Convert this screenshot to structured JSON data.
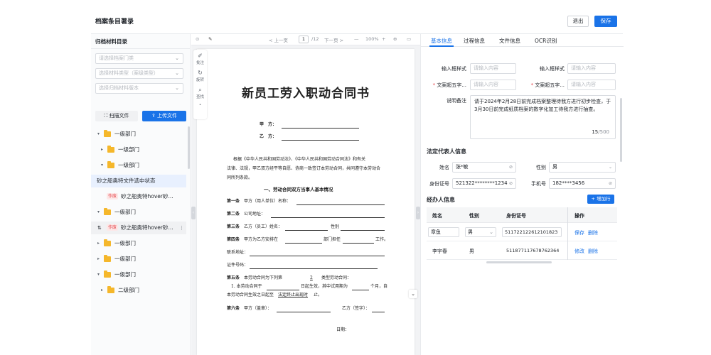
{
  "header": {
    "title": "档案条目著录",
    "exit_label": "退出",
    "save_label": "保存"
  },
  "sidebar": {
    "title": "归档材料目录",
    "selects": [
      {
        "placeholder": "请选择档案门类"
      },
      {
        "placeholder": "选择材料类型（案级类型）"
      },
      {
        "placeholder": "选择归档材料版本"
      }
    ],
    "scan_label": "扫描文件",
    "upload_label": "上传文件",
    "tree": [
      {
        "label": "一级部门",
        "type": "folder",
        "expanded": true
      },
      {
        "label": "一级部门",
        "type": "folder",
        "expanded": false
      },
      {
        "label": "一级部门",
        "type": "folder",
        "expanded": true
      },
      {
        "label": "砂之船奥特文件选中状态",
        "type": "file",
        "state": "selected"
      },
      {
        "label": "砂之船奥特hover砂...",
        "type": "file",
        "tag": "作废"
      },
      {
        "label": "一级部门",
        "type": "folder",
        "expanded": true
      },
      {
        "label": "砂之船奥特hover砂...",
        "type": "file",
        "tag": "作废",
        "state": "hover"
      },
      {
        "label": "一级部门",
        "type": "folder",
        "expanded": false
      },
      {
        "label": "一级部门",
        "type": "folder",
        "expanded": false
      },
      {
        "label": "一级部门",
        "type": "folder",
        "expanded": true
      },
      {
        "label": "二级部门",
        "type": "folder",
        "expanded": false
      }
    ]
  },
  "viewer": {
    "toolbar": {
      "prev": "< 上一页",
      "page": "1",
      "total": "/12",
      "next": "下一页 >",
      "zoom_out": "—",
      "zoom": "100%",
      "zoom_in": "+"
    },
    "side_tools": [
      "批注",
      "旋转",
      "查找"
    ],
    "doc": {
      "title": "新员工劳入职动合同书",
      "party_a": "甲　方：",
      "party_b": "乙　方：",
      "intro1": "根据《中华人民共和国劳动法》、《中华人民共和国劳动合同法》和有关",
      "intro2": "法律、法规，甲乙双方经平等自愿、协商一致签订本劳动合同，共同遵守本劳动合",
      "intro3": "同所列条款。",
      "section1": "一、劳动合同双方当事人基本情况",
      "a1": "第一条",
      "a1_text": "甲方（用人单位）名称：",
      "a2": "第二条",
      "a2_text": "公司地址：",
      "a3": "第三条",
      "a3_text": "乙方（员工）姓名：",
      "a3_gender": "性别",
      "a4": "第四条",
      "a4_text": "甲方为乙方安排在",
      "a4_dept": "部门担任",
      "a4_job": "工作。",
      "contact": "联系地址：",
      "id": "证件号码：",
      "a5": "第五条",
      "a5_text": "本劳动合同为下列第",
      "a5_num": "2",
      "a5_tail": "类型劳动合同：",
      "a5_1": "1. 本劳动合同于",
      "a5_1b": "日起生效，其中试用期为",
      "a5_1c": "个月，自",
      "a5_2": "本劳动合同生效之日起至",
      "a5_2b": "法定终止出现时",
      "a5_2c": "止。",
      "a6": "第六条",
      "a6_text": "甲方（盖章）：",
      "a6_b": "乙方（签字）：",
      "date": "日期："
    }
  },
  "panel": {
    "tabs": [
      "基本信息",
      "过程信息",
      "文件信息",
      "OCR识别"
    ],
    "fields": {
      "style1_label": "输入框样式",
      "style1_ph": "请输入内容",
      "style2_label": "输入框样式",
      "style2_ph": "请输入内容",
      "over1_label": "文案超五字...",
      "over1_ph": "请输入内容",
      "over2_label": "文案超五字...",
      "over2_ph": "请输入内容",
      "note_label": "说明备注",
      "note_value": "请于2024年2月28日前完成档案整理待我方进行初步检查，于3月30日前完成纸质档案的数字化加工待我方进行抽查。",
      "note_count": "15",
      "note_max": "/500"
    },
    "legal": {
      "title": "法定代表人信息",
      "name_label": "姓名",
      "name_value": "张*敏",
      "gender_label": "性别",
      "gender_value": "男",
      "id_label": "身份证号",
      "id_value": "521322********1234",
      "phone_label": "手机号",
      "phone_value": "182****3456"
    },
    "handlers": {
      "title": "经办人信息",
      "add_label": "+ 增加行",
      "columns": [
        "姓名",
        "性别",
        "身份证号",
        "操作"
      ],
      "rows": [
        {
          "name": "章鱼",
          "gender": "男",
          "id": "511722122612101823",
          "a1": "保存",
          "a2": "删除"
        },
        {
          "name": "李宇春",
          "gender": "男",
          "id": "511877117678762364",
          "a1": "修改",
          "a2": "删除"
        }
      ]
    }
  },
  "colors": {
    "primary": "#1a73e8",
    "danger": "#e5484d",
    "folder": "#f5b72b"
  }
}
